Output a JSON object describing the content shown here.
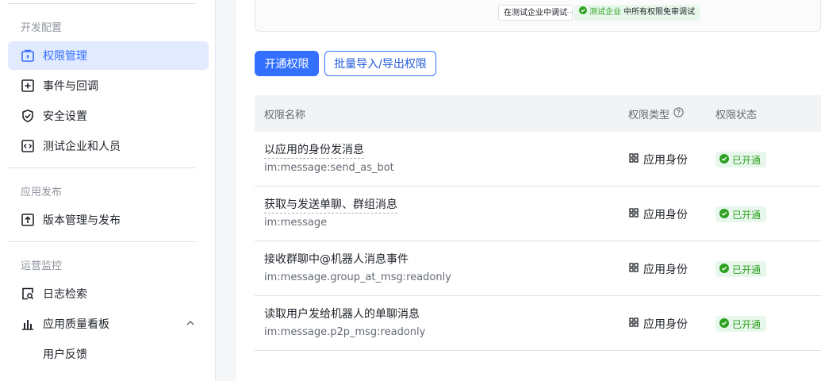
{
  "sidebar": {
    "section_dev": "开发配置",
    "section_release": "应用发布",
    "section_ops": "运营监控",
    "items": [
      {
        "label": "权限管理",
        "icon": "lock-box-icon"
      },
      {
        "label": "事件与回调",
        "icon": "plus-box-icon"
      },
      {
        "label": "安全设置",
        "icon": "shield-check-icon"
      },
      {
        "label": "测试企业和人员",
        "icon": "code-box-icon"
      },
      {
        "label": "版本管理与发布",
        "icon": "upload-box-icon"
      },
      {
        "label": "日志检索",
        "icon": "log-search-icon"
      },
      {
        "label": "应用质量看板",
        "icon": "bar-chart-icon"
      },
      {
        "label": "用户反馈",
        "icon": ""
      }
    ]
  },
  "top_card": {
    "chip_left": "在测试企业中调试",
    "chip_right_prefix": "测试企业",
    "chip_right_suffix": "中所有权限免审调试"
  },
  "toolbar": {
    "enable_label": "开通权限",
    "bulk_label": "批量导入/导出权限"
  },
  "table": {
    "headers": {
      "name": "权限名称",
      "type": "权限类型",
      "status": "权限状态"
    },
    "rows": [
      {
        "name": "以应用的身份发消息",
        "code": "im:message:send_as_bot",
        "type": "应用身份",
        "status": "已开通"
      },
      {
        "name": "获取与发送单聊、群组消息",
        "code": "im:message",
        "type": "应用身份",
        "status": "已开通"
      },
      {
        "name": "接收群聊中@机器人消息事件",
        "code": "im:message.group_at_msg:readonly",
        "type": "应用身份",
        "status": "已开通"
      },
      {
        "name": "读取用户发给机器人的单聊消息",
        "code": "im:message.p2p_msg:readonly",
        "type": "应用身份",
        "status": "已开通"
      }
    ]
  },
  "colors": {
    "accent": "#3370ff",
    "active_bg": "#e1eaff",
    "success": "#2ea121",
    "success_bg": "#e8f7ec"
  }
}
